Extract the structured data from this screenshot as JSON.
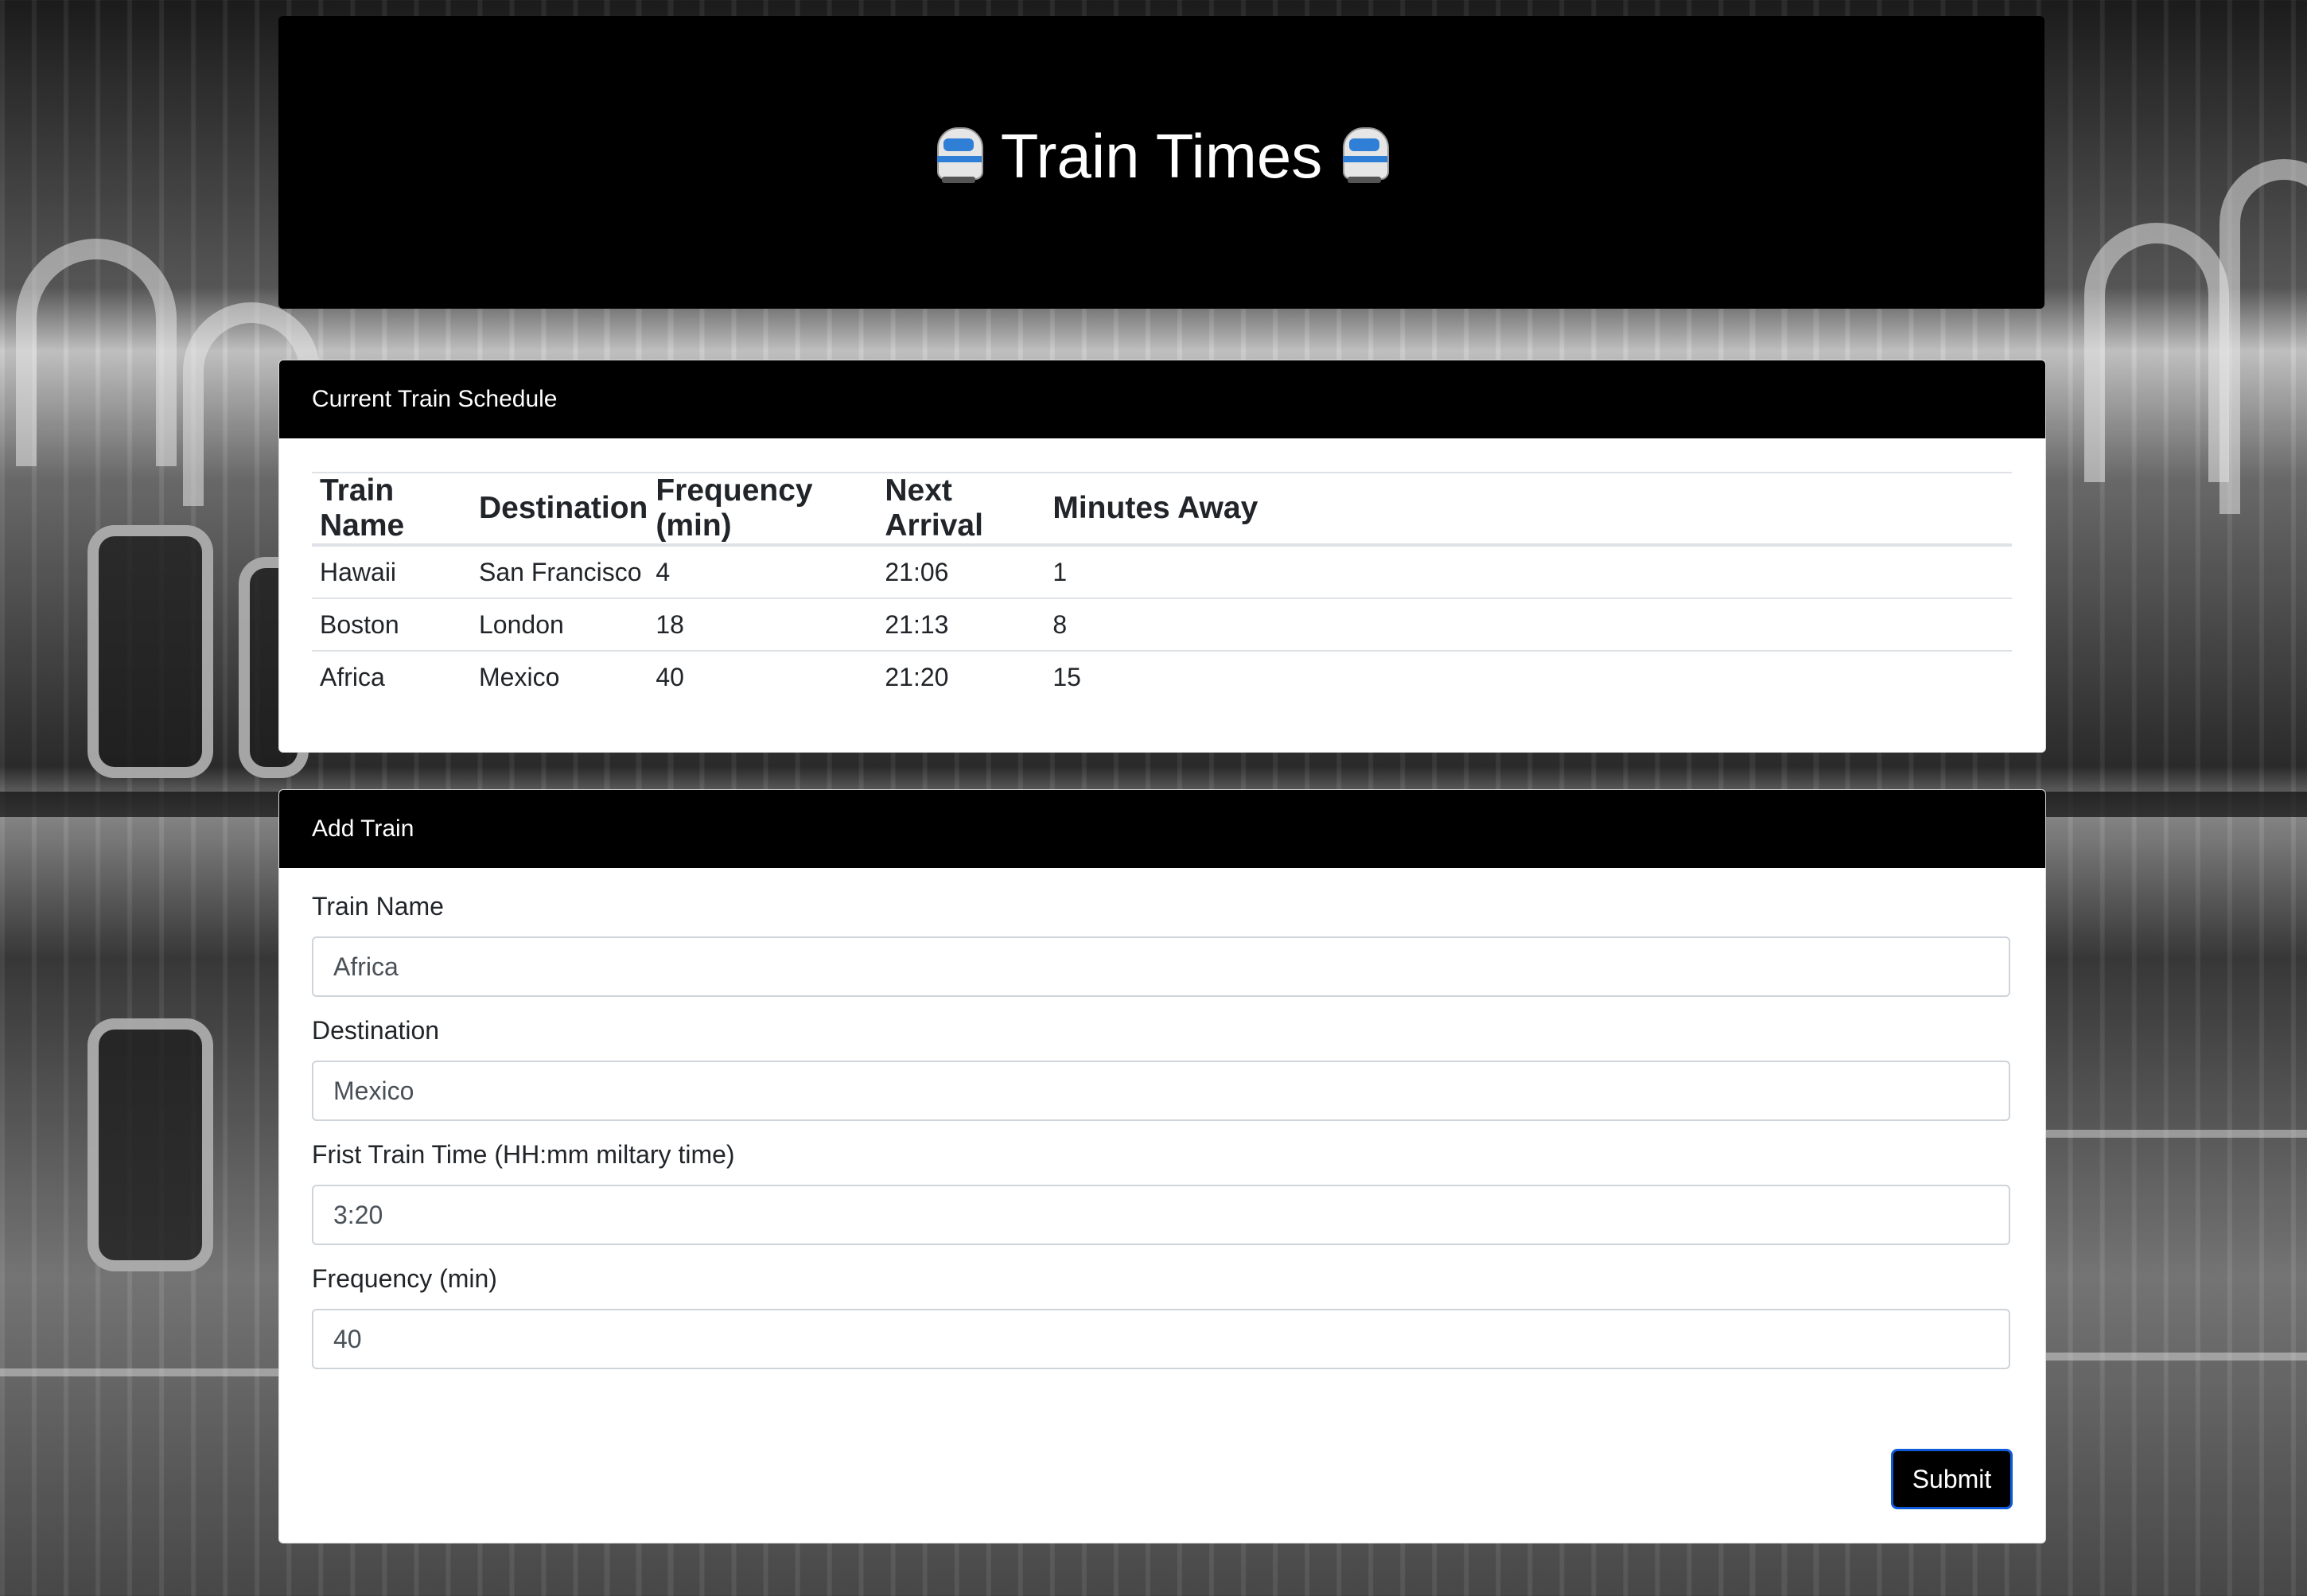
{
  "header": {
    "title": "Train Times",
    "icon_left": "train-emoji",
    "icon_right": "train-emoji"
  },
  "schedule": {
    "heading": "Current Train Schedule",
    "columns": [
      "Train Name",
      "Destination",
      "Frequency (min)",
      "Next Arrival",
      "Minutes Away"
    ],
    "rows": [
      [
        "Hawaii",
        "San Francisco",
        "4",
        "21:06",
        "1"
      ],
      [
        "Boston",
        "London",
        "18",
        "21:13",
        "8"
      ],
      [
        "Africa",
        "Mexico",
        "40",
        "21:20",
        "15"
      ]
    ]
  },
  "add_train": {
    "heading": "Add Train",
    "fields": [
      {
        "label": "Train Name",
        "value": "Africa"
      },
      {
        "label": "Destination",
        "value": "Mexico"
      },
      {
        "label": "Frist Train Time (HH:mm miltary time)",
        "value": "3:20"
      },
      {
        "label": "Frequency (min)",
        "value": "40"
      }
    ],
    "submit_label": "Submit"
  },
  "colors": {
    "header_bg": "#000000",
    "card_bg": "#ffffff",
    "button_border": "#0d5bd8"
  }
}
